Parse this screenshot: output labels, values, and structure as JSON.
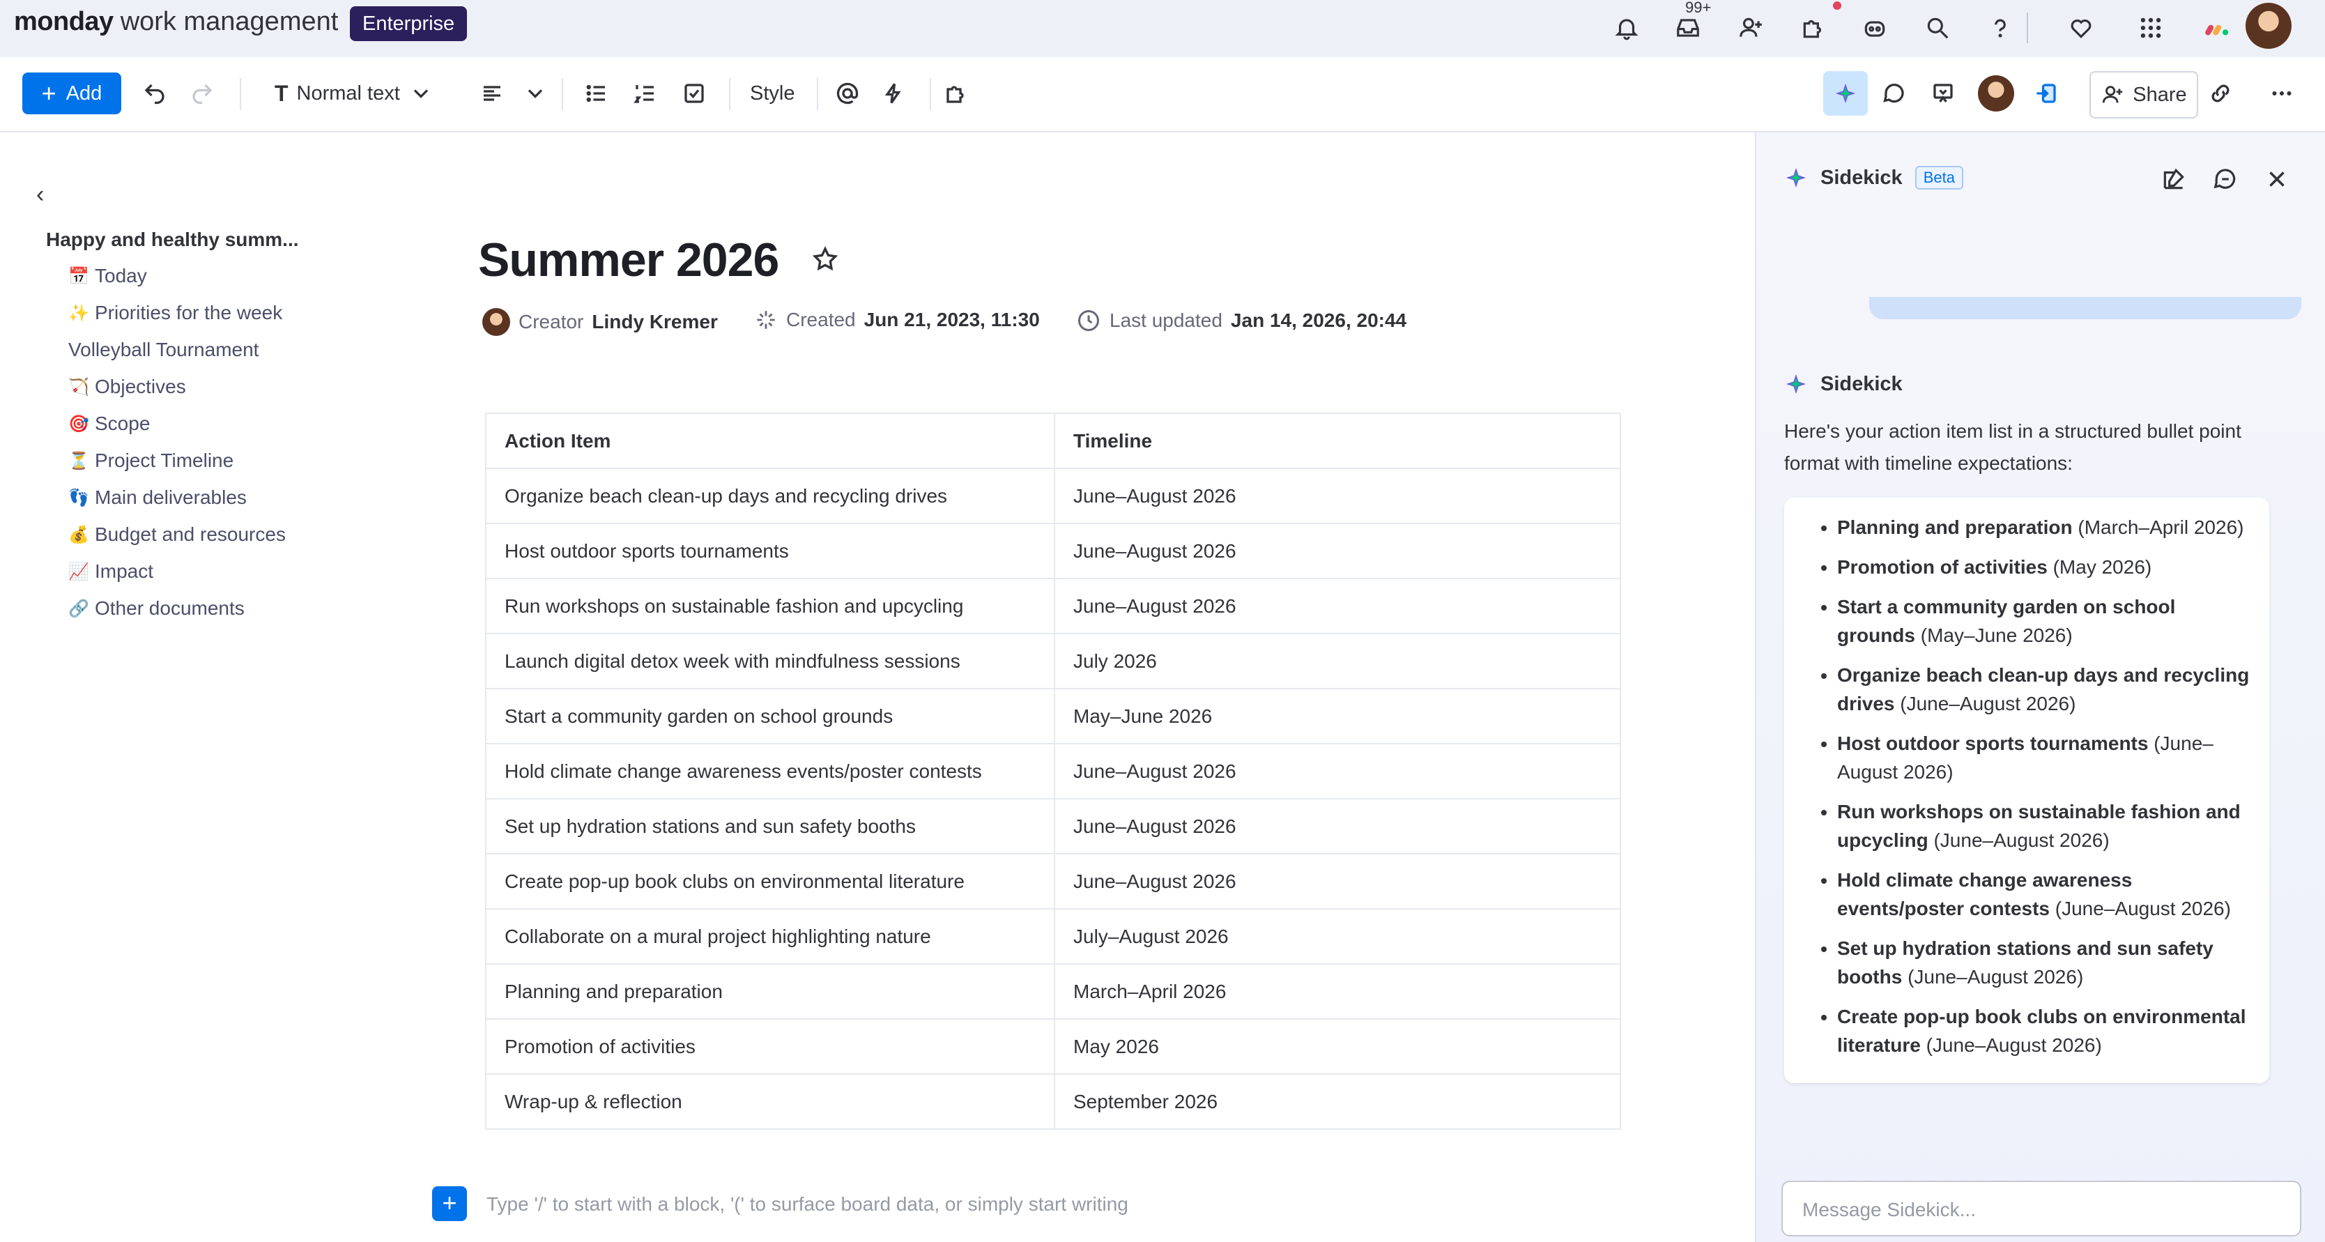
{
  "topbar": {
    "brand_bold": "monday",
    "brand_rest": "work management",
    "plan_badge": "Enterprise",
    "notification_count": "99+"
  },
  "toolbar": {
    "add_label": "Add",
    "text_style": "Normal text",
    "style_label": "Style",
    "share_label": "Share"
  },
  "sidebar": {
    "workspace_title": "Happy and healthy summ...",
    "items": [
      {
        "emoji": "📅",
        "label": "Today"
      },
      {
        "emoji": "✨",
        "label": "Priorities for the week"
      },
      {
        "emoji": "",
        "label": "Volleyball Tournament"
      },
      {
        "emoji": "🏹",
        "label": "Objectives"
      },
      {
        "emoji": "🎯",
        "label": "Scope"
      },
      {
        "emoji": "⏳",
        "label": "Project Timeline"
      },
      {
        "emoji": "👣",
        "label": "Main deliverables"
      },
      {
        "emoji": "💰",
        "label": "Budget and resources"
      },
      {
        "emoji": "📈",
        "label": "Impact"
      },
      {
        "emoji": "🔗",
        "label": "Other documents"
      }
    ]
  },
  "doc": {
    "title": "Summer 2026",
    "creator_label": "Creator",
    "creator_name": "Lindy Kremer",
    "created_label": "Created",
    "created_value": "Jun 21, 2023, 11:30",
    "updated_label": "Last updated",
    "updated_value": "Jan 14, 2026, 20:44",
    "table": {
      "headers": [
        "Action Item",
        "Timeline"
      ],
      "rows": [
        [
          "Organize beach clean-up days and recycling drives",
          "June–August 2026"
        ],
        [
          "Host outdoor sports tournaments",
          "June–August 2026"
        ],
        [
          "Run workshops on sustainable fashion and upcycling",
          "June–August 2026"
        ],
        [
          "Launch digital detox week with mindfulness sessions",
          "July 2026"
        ],
        [
          "Start a community garden on school grounds",
          "May–June 2026"
        ],
        [
          "Hold climate change awareness events/poster contests",
          "June–August 2026"
        ],
        [
          "Set up hydration stations and sun safety booths",
          "June–August 2026"
        ],
        [
          "Create pop-up book clubs on environmental literature",
          "June–August 2026"
        ],
        [
          "Collaborate on a mural project highlighting nature",
          "July–August 2026"
        ],
        [
          "Planning and preparation",
          "March–April 2026"
        ],
        [
          "Promotion of activities",
          "May 2026"
        ],
        [
          "Wrap-up & reflection",
          "September 2026"
        ]
      ]
    },
    "placeholder": "Type '/' to start with a block, '(' to surface board data, or simply start writing"
  },
  "sidekick": {
    "title": "Sidekick",
    "beta": "Beta",
    "responder": "Sidekick",
    "intro": "Here's your action item list in a structured bullet point format with timeline expectations:",
    "bullets": [
      {
        "bold": "Planning and preparation",
        "rest": " (March–April 2026)"
      },
      {
        "bold": "Promotion of activities",
        "rest": " (May 2026)"
      },
      {
        "bold": "Start a community garden on school grounds",
        "rest": " (May–June 2026)"
      },
      {
        "bold": "Organize beach clean-up days and recycling drives",
        "rest": " (June–August 2026)"
      },
      {
        "bold": "Host outdoor sports tournaments",
        "rest": " (June–August 2026)"
      },
      {
        "bold": "Run workshops on sustainable fashion and upcycling",
        "rest": " (June–August 2026)"
      },
      {
        "bold": "Hold climate change awareness events/poster contests",
        "rest": " (June–August 2026)"
      },
      {
        "bold": "Set up hydration stations and sun safety booths",
        "rest": " (June–August 2026)"
      },
      {
        "bold": "Create pop-up book clubs on environmental literature",
        "rest": " (June–August 2026)"
      }
    ],
    "message_placeholder": "Message Sidekick..."
  },
  "colors": {
    "accent": "#0073ea",
    "enterprise_badge": "#2b1f5c",
    "page_bg": "#eef0f8"
  }
}
